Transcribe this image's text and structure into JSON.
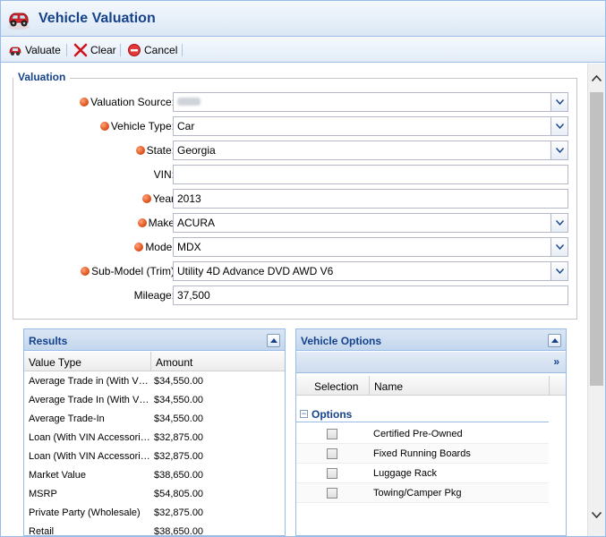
{
  "window": {
    "title": "Vehicle Valuation",
    "app_icon": "car-icon"
  },
  "toolbar": {
    "valuate_label": "Valuate",
    "clear_label": "Clear",
    "cancel_label": "Cancel"
  },
  "valuation": {
    "legend": "Valuation",
    "fields": {
      "valuation_source": {
        "label": "Valuation Source:",
        "value": "",
        "required": true
      },
      "vehicle_type": {
        "label": "Vehicle Type:",
        "value": "Car",
        "required": true
      },
      "state": {
        "label": "State:",
        "value": "Georgia",
        "required": true
      },
      "vin": {
        "label": "VIN:",
        "value": "",
        "required": false
      },
      "year": {
        "label": "Year",
        "value": "2013",
        "required": true
      },
      "make": {
        "label": "Make",
        "value": "ACURA",
        "required": true
      },
      "model": {
        "label": "Model",
        "value": "MDX",
        "required": true
      },
      "sub_model": {
        "label": "Sub-Model (Trim)",
        "value": "Utility 4D Advance DVD AWD V6",
        "required": true
      },
      "mileage": {
        "label": "Mileage:",
        "value": "37,500",
        "required": false
      }
    }
  },
  "results": {
    "title": "Results",
    "columns": [
      "Value Type",
      "Amount"
    ],
    "rows": [
      {
        "type": "Average Trade in (With VIN Accessories)",
        "amount": "$34,550.00"
      },
      {
        "type": "Average Trade In (With VIN Accessories)",
        "amount": "$34,550.00"
      },
      {
        "type": "Average Trade-In",
        "amount": "$34,550.00"
      },
      {
        "type": "Loan (With VIN Accessories)",
        "amount": "$32,875.00"
      },
      {
        "type": "Loan (With VIN Accessories)",
        "amount": "$32,875.00"
      },
      {
        "type": "Market Value",
        "amount": "$38,650.00"
      },
      {
        "type": "MSRP",
        "amount": "$54,805.00"
      },
      {
        "type": "Private Party (Wholesale)",
        "amount": "$32,875.00"
      },
      {
        "type": "Retail",
        "amount": "$38,650.00"
      }
    ]
  },
  "vehicle_options": {
    "title": "Vehicle Options",
    "columns": [
      "Selection",
      "Name"
    ],
    "group_label": "Options",
    "items": [
      {
        "name": "Certified Pre-Owned",
        "selected": false
      },
      {
        "name": "Fixed Running Boards",
        "selected": false
      },
      {
        "name": "Luggage Rack",
        "selected": false
      },
      {
        "name": "Towing/Camper Pkg",
        "selected": false
      }
    ]
  },
  "colors": {
    "accent": "#15428b",
    "border": "#99bbe8",
    "required_dot": "#e0551e"
  }
}
